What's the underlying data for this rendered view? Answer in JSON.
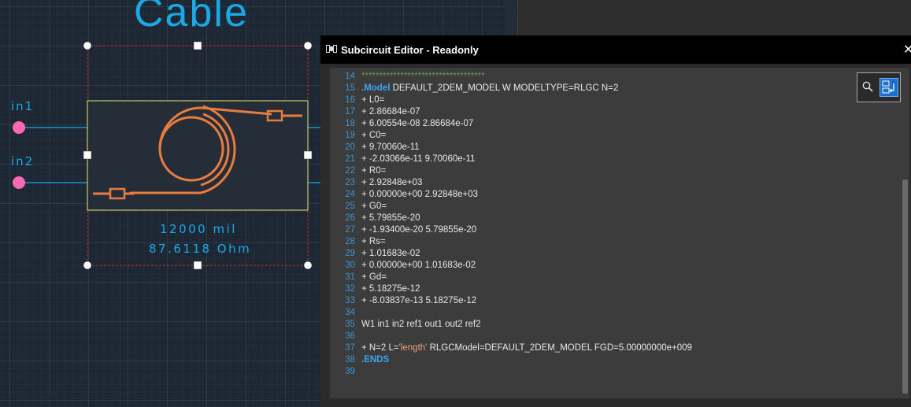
{
  "schematic": {
    "component_title": "Cable",
    "port_in1": "in1",
    "port_in2": "in2",
    "length_text": "12000 mil",
    "impedance_text": "87.6118 Ohm"
  },
  "editor": {
    "title": "Subcircuit Editor - Readonly",
    "close_label": "✕",
    "search_icon": "search-icon",
    "replace_icon": "replace-icon",
    "lines": [
      {
        "num": "14",
        "text": "***********************************",
        "style": "cmt"
      },
      {
        "num": "15",
        "kw": ".Model",
        "text": " DEFAULT_2DEM_MODEL W MODELTYPE=RLGC N=2"
      },
      {
        "num": "16",
        "text": "+ L0="
      },
      {
        "num": "17",
        "text": "+ 2.86684e-07"
      },
      {
        "num": "18",
        "text": "+ 6.00554e-08 2.86684e-07"
      },
      {
        "num": "19",
        "text": "+ C0="
      },
      {
        "num": "20",
        "text": "+ 9.70060e-11"
      },
      {
        "num": "21",
        "text": "+ -2.03066e-11 9.70060e-11"
      },
      {
        "num": "22",
        "text": "+ R0="
      },
      {
        "num": "23",
        "text": "+ 2.92848e+03"
      },
      {
        "num": "24",
        "text": "+ 0.00000e+00 2.92848e+03"
      },
      {
        "num": "25",
        "text": "+ G0="
      },
      {
        "num": "26",
        "text": "+ 5.79855e-20"
      },
      {
        "num": "27",
        "text": "+ -1.93400e-20 5.79855e-20"
      },
      {
        "num": "28",
        "text": "+ Rs="
      },
      {
        "num": "29",
        "text": "+ 1.01683e-02"
      },
      {
        "num": "30",
        "text": "+ 0.00000e+00 1.01683e-02"
      },
      {
        "num": "31",
        "text": "+ Gd="
      },
      {
        "num": "32",
        "text": "+ 5.18275e-12"
      },
      {
        "num": "33",
        "text": "+ -8.03837e-13 5.18275e-12"
      },
      {
        "num": "34",
        "text": ""
      },
      {
        "num": "35",
        "text": "W1 in1 in2 ref1 out1 out2 ref2"
      },
      {
        "num": "36",
        "text": ""
      },
      {
        "num": "37",
        "pre": "+ N=2 L=",
        "str": "'length'",
        "text": " RLGCModel=DEFAULT_2DEM_MODEL FGD=5.00000000e+009"
      },
      {
        "num": "38",
        "kw": ".ENDS",
        "text": ""
      },
      {
        "num": "39",
        "text": ""
      }
    ]
  },
  "colors": {
    "accent": "#1aa8e6",
    "port": "#ff69b4",
    "cable": "#e87c3e",
    "selection": "#cc2222"
  }
}
